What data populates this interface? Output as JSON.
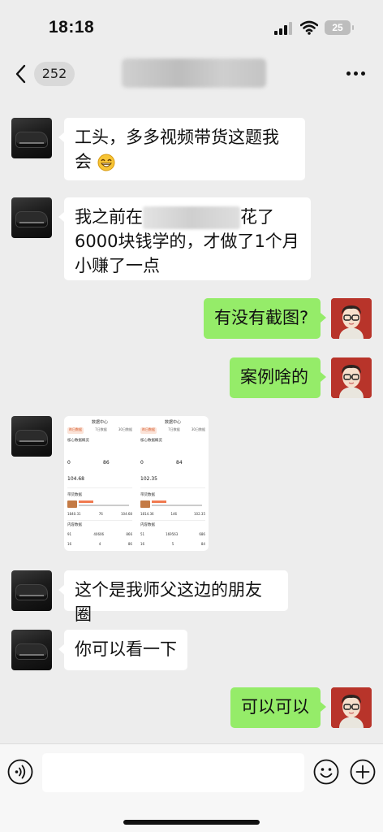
{
  "status_bar": {
    "time": "18:18",
    "battery": "25"
  },
  "nav": {
    "unread_count": "252"
  },
  "messages": [
    {
      "side": "left",
      "text": "工头，多多视频带货这题我会"
    },
    {
      "side": "left",
      "line1_pre": "我之前在",
      "line1_post": "花了",
      "line2": "6000块钱学的，才做了1个月",
      "line3": "小赚了一点"
    },
    {
      "side": "right",
      "text": "有没有截图?"
    },
    {
      "side": "right",
      "text": "案例啥的"
    },
    {
      "side": "left",
      "type": "image",
      "panels": [
        {
          "title": "数据中心",
          "tabs": [
            "昨日数据",
            "7日数据",
            "30日数据"
          ],
          "section": "核心数据概览",
          "num_a": "0",
          "num_b": "86",
          "num_c": "104.68",
          "goods": "带货数据",
          "grid1": [
            "1840.31",
            "76",
            "104.68"
          ],
          "content": "内容数据",
          "grid2": [
            "91",
            "40606",
            "866"
          ],
          "grid3": [
            "16",
            "4",
            "86"
          ]
        },
        {
          "title": "数据中心",
          "tabs": [
            "昨日数据",
            "7日数据",
            "30日数据"
          ],
          "section": "核心数据概览",
          "num_a": "0",
          "num_b": "84",
          "num_c": "102.35",
          "goods": "带货数据",
          "grid1": [
            "1814.36",
            "146",
            "102.35"
          ],
          "content": "内容数据",
          "grid2": [
            "51",
            "169563",
            "686"
          ],
          "grid3": [
            "16",
            "5",
            "84"
          ]
        }
      ]
    },
    {
      "side": "left",
      "text": "这个是我师父这边的朋友圈"
    },
    {
      "side": "left",
      "text": "你可以看一下"
    },
    {
      "side": "right",
      "text": "可以可以"
    }
  ],
  "input": {
    "value": ""
  },
  "icons": {
    "back": "chevron-left-icon",
    "more": "more-icon",
    "voice": "voice-icon",
    "emoji": "emoji-icon",
    "plus": "plus-icon"
  }
}
